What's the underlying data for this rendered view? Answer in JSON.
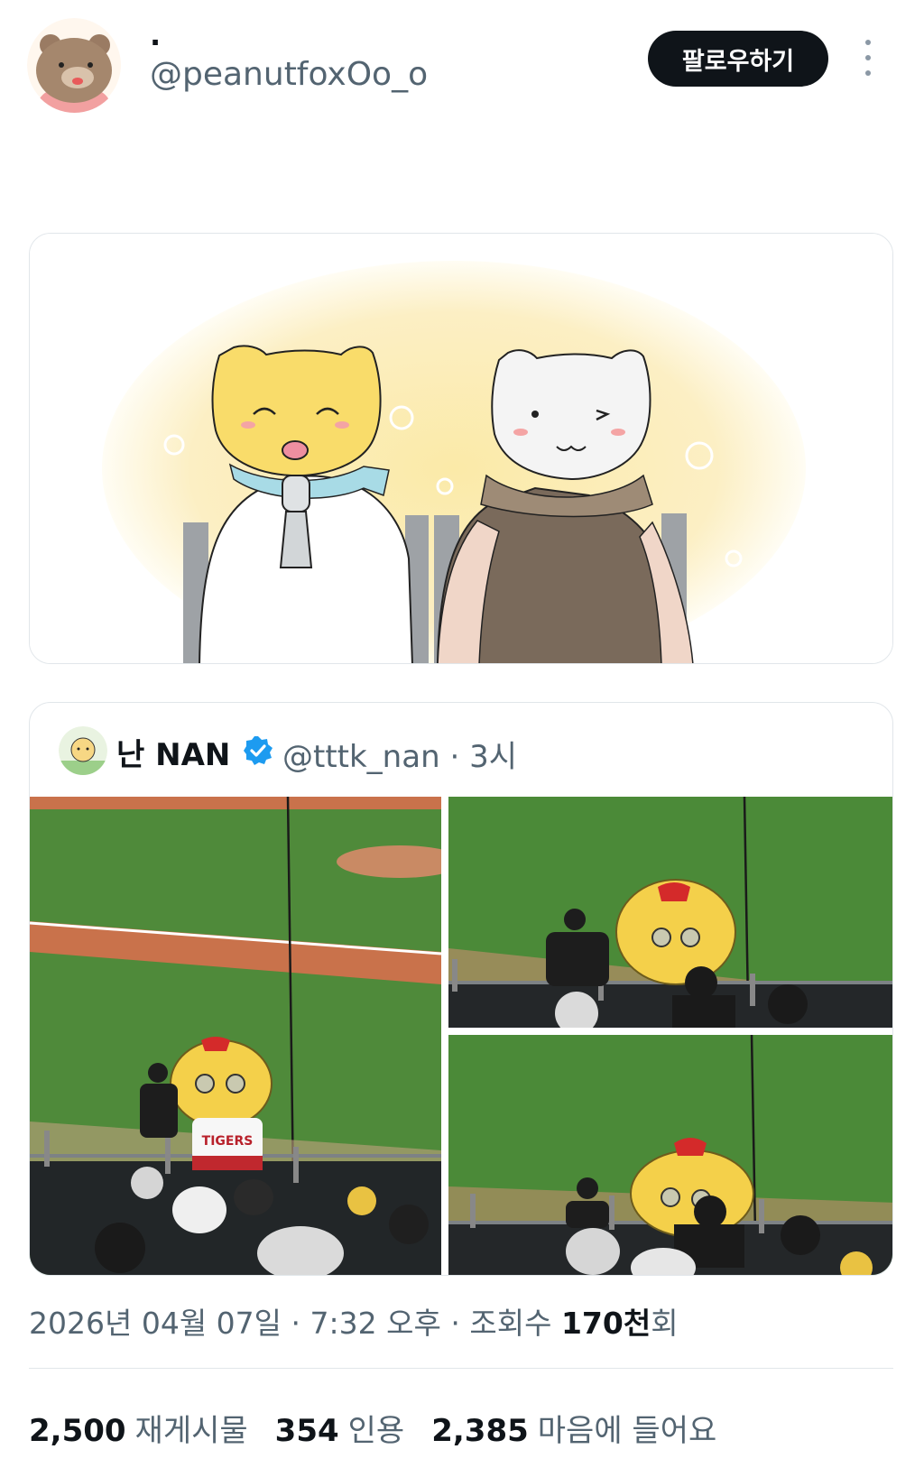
{
  "header": {
    "display_name": "·",
    "handle": "@peanutfoxOo_o",
    "follow_label": "팔로우하기"
  },
  "quote": {
    "name": "난 NAN",
    "handle": "@tttk_nan",
    "separator": "·",
    "time": "3시",
    "jersey_text": "TIGERS"
  },
  "meta": {
    "date": "2026년 04월 07일",
    "time": "7:32 오후",
    "sep": "·",
    "views_label": "조회수",
    "views_value": "170천",
    "views_suffix": "회"
  },
  "stats": {
    "reposts_count": "2,500",
    "reposts_label": "재게시물",
    "quotes_count": "354",
    "quotes_label": "인용",
    "likes_count": "2,385",
    "likes_label": "마음에 들어요"
  },
  "colors": {
    "text": "#0f1419",
    "secondary": "#536471",
    "verified": "#1d9bf0",
    "grass": "#4f8a3a",
    "dirt": "#c9724b",
    "glow": "#fbeec0"
  },
  "icons": [
    "more-vertical-icon",
    "verified-badge-icon"
  ]
}
